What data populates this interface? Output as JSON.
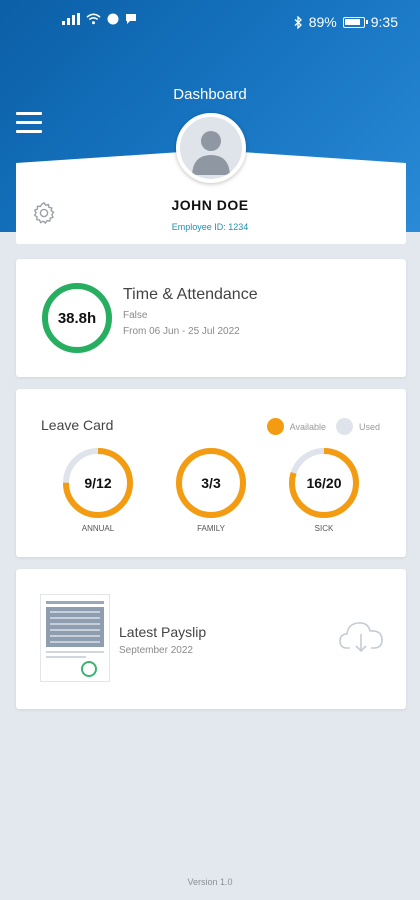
{
  "status_bar": {
    "battery": "89%",
    "time": "9:35"
  },
  "header": {
    "title": "Dashboard"
  },
  "profile": {
    "name": "JOHN DOE",
    "employee_id": "Employee ID: 1234"
  },
  "attendance": {
    "hours": "38.8h",
    "title": "Time & Attendance",
    "subtitle": "False",
    "range": "From 06 Jun - 25 Jul 2022",
    "ring_color": "#27ae60"
  },
  "leave": {
    "title": "Leave Card",
    "legend": {
      "available": "Available",
      "used": "Used",
      "available_color": "#f39c12",
      "used_color": "#dfe4ec"
    },
    "items": [
      {
        "value": "9/12",
        "label": "ANNUAL",
        "available": 9,
        "total": 12
      },
      {
        "value": "3/3",
        "label": "FAMILY",
        "available": 3,
        "total": 3
      },
      {
        "value": "16/20",
        "label": "SICK",
        "available": 16,
        "total": 20
      }
    ]
  },
  "payslip": {
    "title": "Latest Payslip",
    "date": "September 2022"
  },
  "footer": {
    "version": "Version 1.0"
  },
  "colors": {
    "primary": "#0b5fa6",
    "accent": "#f39c12",
    "success": "#27ae60"
  }
}
